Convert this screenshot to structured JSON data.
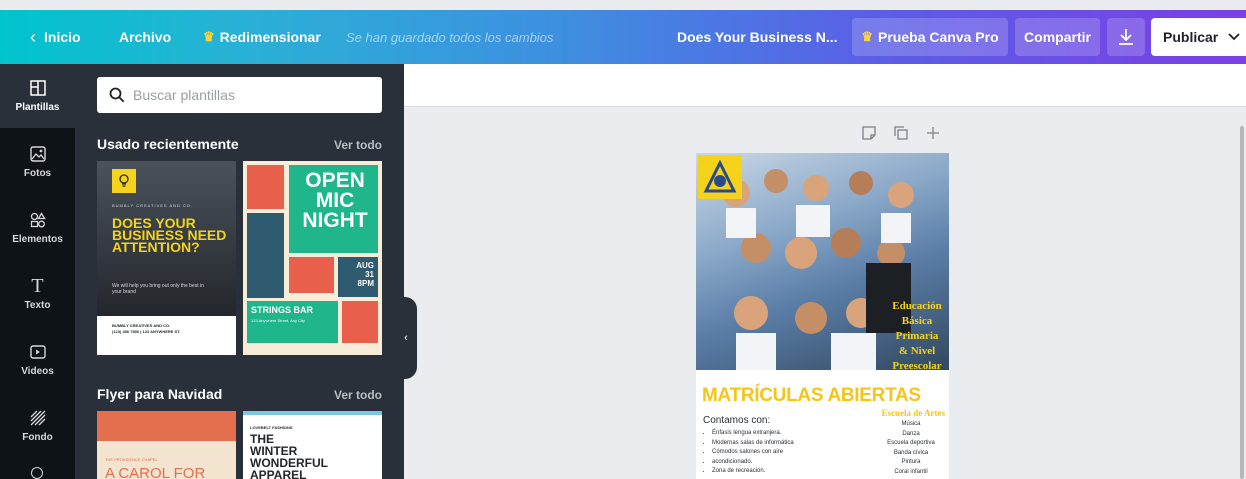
{
  "topbar": {
    "back_label": "Inicio",
    "file_label": "Archivo",
    "resize_label": "Redimensionar",
    "saved_status": "Se han guardado todos los cambios",
    "doc_title": "Does Your Business N...",
    "try_pro_label": "Prueba Canva Pro",
    "share_label": "Compartir",
    "publish_label": "Publicar",
    "gradient_colors": [
      "#00c4cc",
      "#7b3fe4"
    ]
  },
  "rail": {
    "items": [
      {
        "label": "Plantillas",
        "icon": "templates-icon"
      },
      {
        "label": "Fotos",
        "icon": "photos-icon"
      },
      {
        "label": "Elementos",
        "icon": "elements-icon"
      },
      {
        "label": "Texto",
        "icon": "text-icon"
      },
      {
        "label": "Videos",
        "icon": "video-icon"
      },
      {
        "label": "Fondo",
        "icon": "background-icon"
      }
    ]
  },
  "panel": {
    "search_placeholder": "Buscar plantillas",
    "sections": [
      {
        "title": "Usado recientemente",
        "see_all": "Ver todo"
      },
      {
        "title": "Flyer para Navidad",
        "see_all": "Ver todo"
      }
    ],
    "templates": {
      "business": {
        "brand": "BUMBLY CREATIVES AND CO.",
        "headline": "DOES YOUR BUSINESS NEED ATTENTION?",
        "body": "We will help you bring out only the best in your brand",
        "footer_company": "BUMBLY CREATIVES AND CO.",
        "footer_phone": "(123) 456 7890 | 123 ANYWHERE ST."
      },
      "openmic": {
        "headline": "OPEN MIC NIGHT",
        "date_month": "AUG",
        "date_day": "31",
        "date_time": "8PM",
        "venue": "STRINGS BAR",
        "venue_address": "123 Anywhere Street, Any City"
      },
      "carol": {
        "line1": "A CAROL FOR",
        "small": "THE PROVIDENCE CHAPEL"
      },
      "winter": {
        "small": "LOVEBELT FASHIONS",
        "headline": "THE WINTER WONDERFUL APPAREL SALE"
      }
    }
  },
  "canvas": {
    "page": {
      "side_text": [
        "Educación",
        "Básica",
        "Primaria",
        "& Nivel",
        "Preescolar"
      ],
      "headline": "MATRÍCULAS ABIERTAS",
      "left_title": "Contamos con:",
      "left_items": [
        "Énfasis lengua extranjera.",
        "Modernas salas de informática",
        "Cómodos salones con aire",
        "acondicionado.",
        "Zona de recreación."
      ],
      "right_title": "Escuela de Artes",
      "right_items": [
        "Música",
        "Danza",
        "Escuela deportiva",
        "Banda cívica",
        "Pintura",
        "Coral infantil"
      ]
    }
  }
}
